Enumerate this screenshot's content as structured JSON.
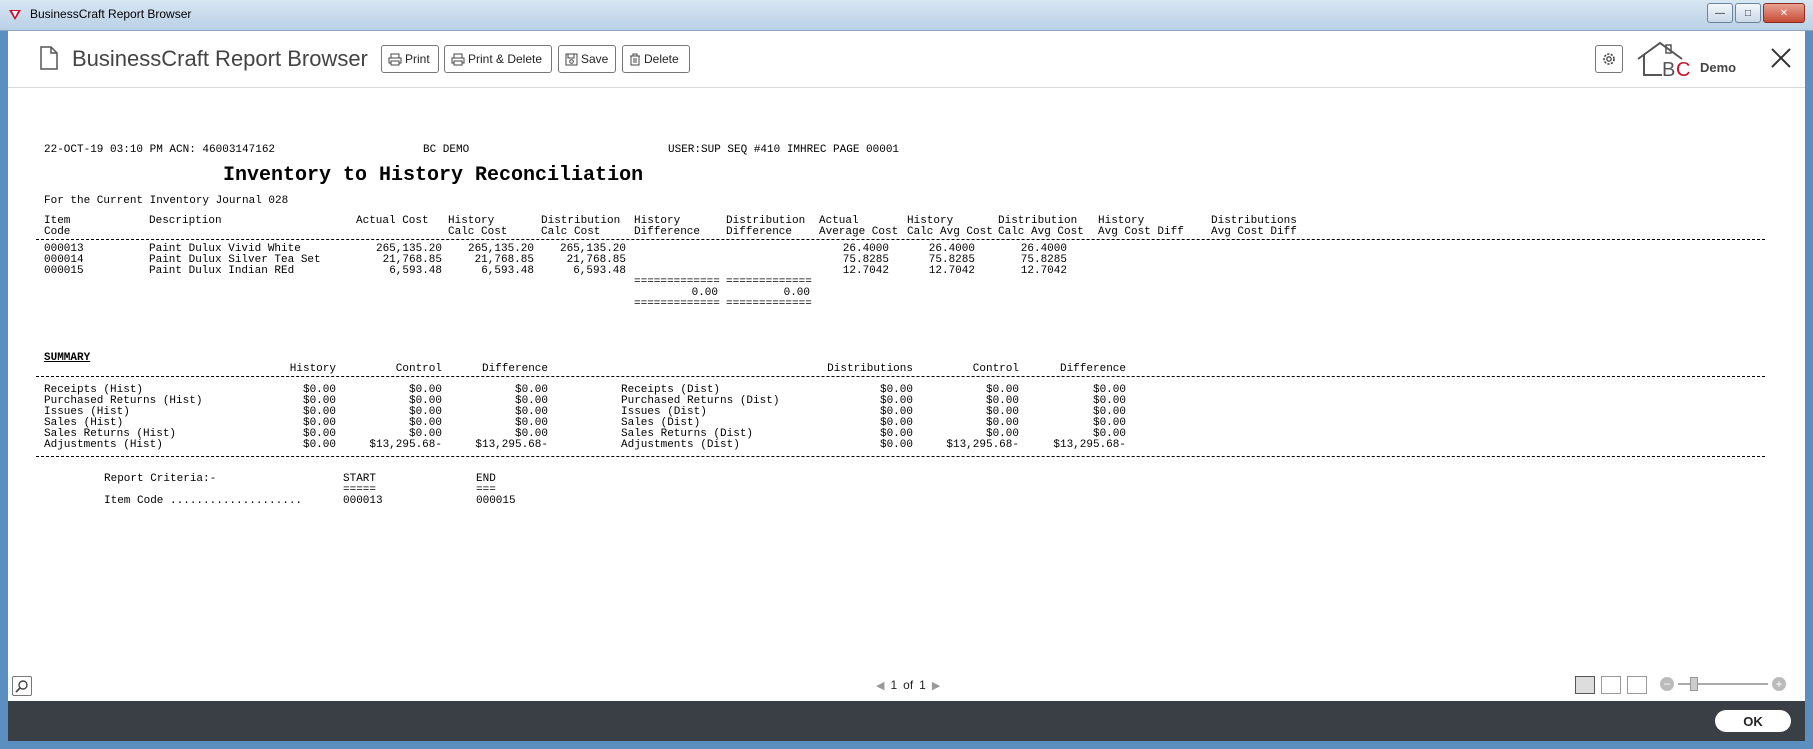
{
  "window": {
    "title": "BusinessCraft Report Browser"
  },
  "toolbar": {
    "title": "BusinessCraft Report Browser",
    "print_label": "Print",
    "print_delete_label": "Print & Delete",
    "save_label": "Save",
    "delete_label": "Delete",
    "logo_text": "BC",
    "demo_label": "Demo"
  },
  "report": {
    "header_left": "22-OCT-19 03:10 PM ACN: 46003147162",
    "header_mid": "BC DEMO",
    "header_right": "USER:SUP SEQ #410 IMHREC PAGE 00001",
    "title": "Inventory to History Reconciliation",
    "subtitle": "For the Current Inventory Journal 028",
    "columns": [
      {
        "l1": "Item",
        "l2": "Code"
      },
      {
        "l1": "Description",
        "l2": ""
      },
      {
        "l1": "Actual Cost",
        "l2": ""
      },
      {
        "l1": "History",
        "l2": "Calc Cost"
      },
      {
        "l1": "Distribution",
        "l2": "Calc Cost"
      },
      {
        "l1": "History",
        "l2": "Difference"
      },
      {
        "l1": "Distribution",
        "l2": "Difference"
      },
      {
        "l1": "Actual",
        "l2": "Average Cost"
      },
      {
        "l1": "History",
        "l2": "Calc Avg Cost"
      },
      {
        "l1": "Distribution",
        "l2": "Calc Avg Cost"
      },
      {
        "l1": "History",
        "l2": "Avg Cost Diff"
      },
      {
        "l1": "Distributions",
        "l2": "Avg Cost Diff"
      }
    ],
    "rows": [
      {
        "code": "000013",
        "desc": "Paint Dulux Vivid White",
        "actual": "265,135.20",
        "hist_calc": "265,135.20",
        "dist_calc": "265,135.20",
        "actual_avg": "26.4000",
        "hist_avg": "26.4000",
        "dist_avg": "26.4000"
      },
      {
        "code": "000014",
        "desc": "Paint Dulux Silver Tea Set",
        "actual": "21,768.85",
        "hist_calc": "21,768.85",
        "dist_calc": "21,768.85",
        "actual_avg": "75.8285",
        "hist_avg": "75.8285",
        "dist_avg": "75.8285"
      },
      {
        "code": "000015",
        "desc": "Paint Dulux Indian REd",
        "actual": "6,593.48",
        "hist_calc": "6,593.48",
        "dist_calc": "6,593.48",
        "actual_avg": "12.7042",
        "hist_avg": "12.7042",
        "dist_avg": "12.7042"
      }
    ],
    "totals_rule": "=============",
    "hist_diff_total": "0.00",
    "dist_diff_total": "0.00",
    "summary": {
      "heading": "SUMMARY",
      "col_history": "History",
      "col_control": "Control",
      "col_difference": "Difference",
      "col_distributions": "Distributions",
      "col_control2": "Control",
      "col_difference2": "Difference",
      "rows": [
        {
          "hl": "Receipts (Hist)",
          "h": "$0.00",
          "hc": "$0.00",
          "hd": "$0.00",
          "dl": "Receipts (Dist)",
          "d": "$0.00",
          "dc": "$0.00",
          "dd": "$0.00"
        },
        {
          "hl": "Purchased Returns (Hist)",
          "h": "$0.00",
          "hc": "$0.00",
          "hd": "$0.00",
          "dl": "Purchased Returns (Dist)",
          "d": "$0.00",
          "dc": "$0.00",
          "dd": "$0.00"
        },
        {
          "hl": "Issues (Hist)",
          "h": "$0.00",
          "hc": "$0.00",
          "hd": "$0.00",
          "dl": "Issues (Dist)",
          "d": "$0.00",
          "dc": "$0.00",
          "dd": "$0.00"
        },
        {
          "hl": "Sales (Hist)",
          "h": "$0.00",
          "hc": "$0.00",
          "hd": "$0.00",
          "dl": "Sales (Dist)",
          "d": "$0.00",
          "dc": "$0.00",
          "dd": "$0.00"
        },
        {
          "hl": "Sales Returns (Hist)",
          "h": "$0.00",
          "hc": "$0.00",
          "hd": "$0.00",
          "dl": "Sales Returns (Dist)",
          "d": "$0.00",
          "dc": "$0.00",
          "dd": "$0.00"
        },
        {
          "hl": "Adjustments (Hist)",
          "h": "$0.00",
          "hc": "$13,295.68-",
          "hd": "$13,295.68-",
          "dl": "Adjustments (Dist)",
          "d": "$0.00",
          "dc": "$13,295.68-",
          "dd": "$13,295.68-"
        }
      ]
    },
    "criteria": {
      "label": "Report Criteria:-",
      "start_label": "START",
      "start_rule": "=====",
      "end_label": "END",
      "end_rule": "===",
      "item_label": "Item Code ....................",
      "item_start": "000013",
      "item_end": "000015"
    }
  },
  "pager": {
    "current": "1",
    "of_label": "of",
    "total": "1"
  },
  "footer": {
    "ok_label": "OK"
  },
  "colors": {
    "footer_bg": "#3a3f45",
    "logo_red": "#c8102e"
  }
}
